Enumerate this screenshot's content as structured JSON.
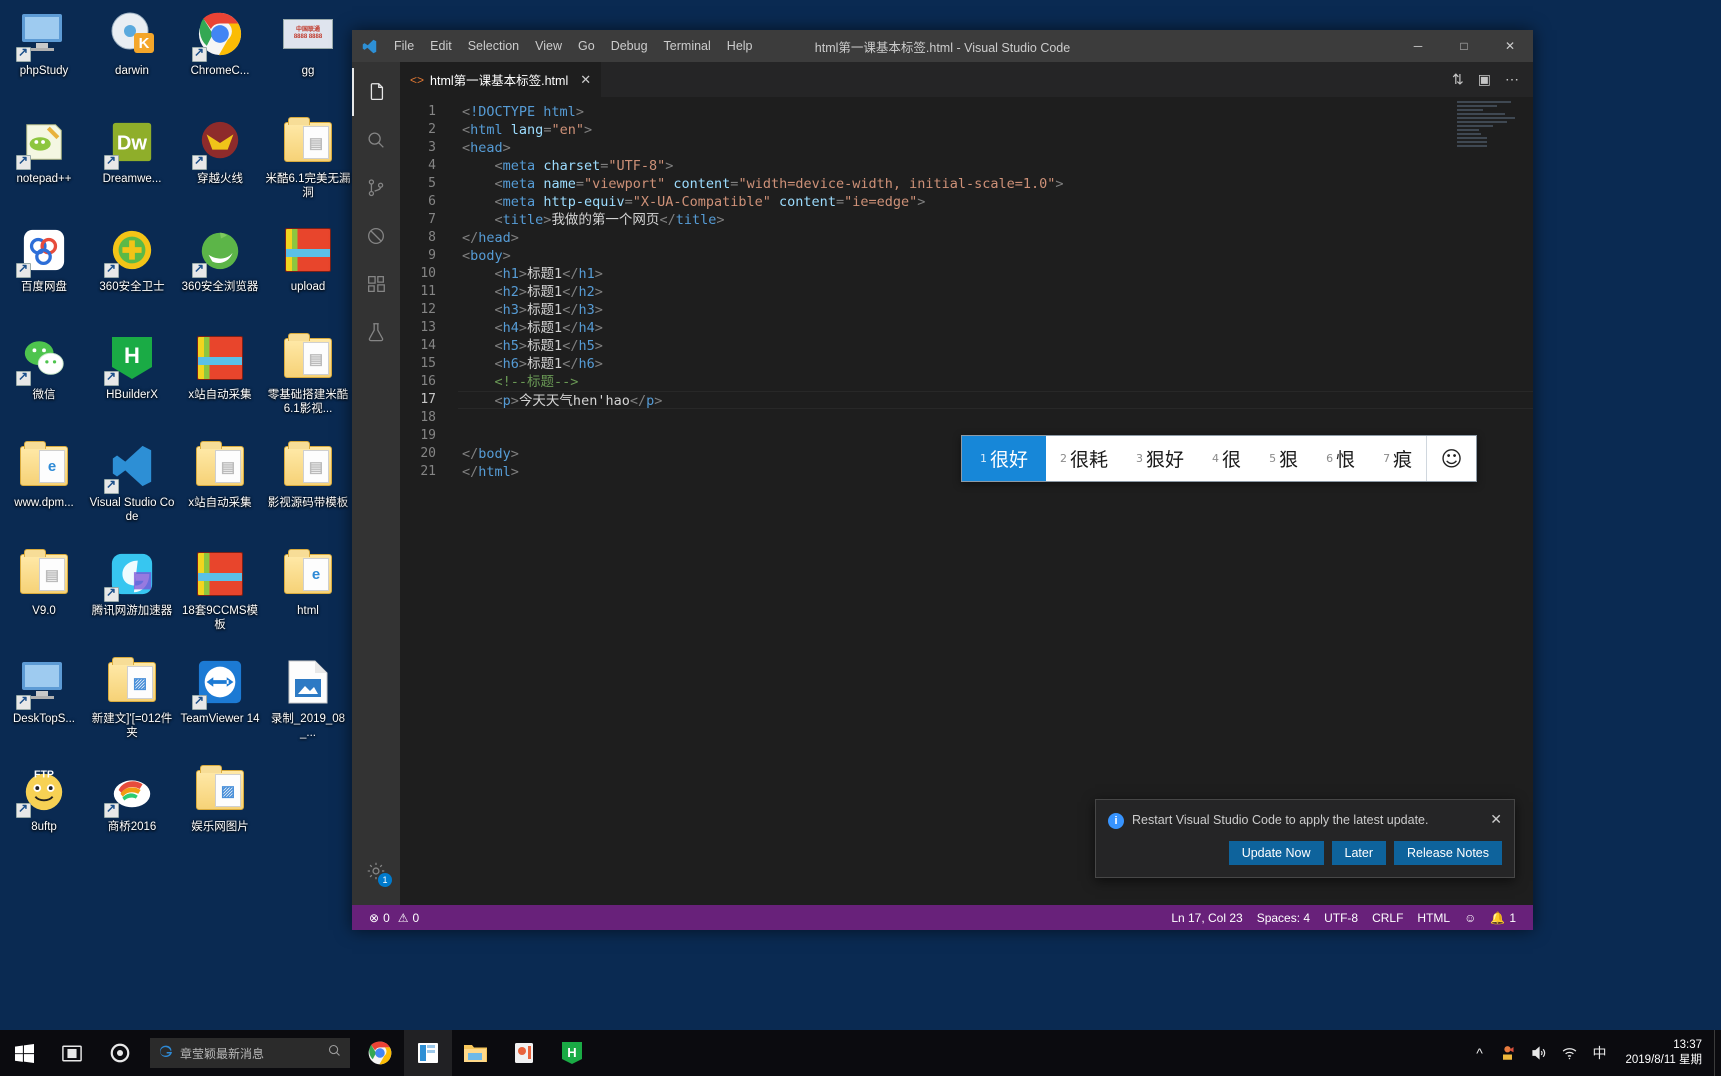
{
  "desktop": {
    "icons": [
      {
        "label": "phpStudy",
        "glyph": "monitor",
        "shortcut": true
      },
      {
        "label": "darwin",
        "glyph": "disc-k",
        "shortcut": false
      },
      {
        "label": "ChromeC...",
        "glyph": "chrome",
        "shortcut": true
      },
      {
        "label": "gg",
        "glyph": "card",
        "shortcut": false
      },
      {
        "label": "notepad++",
        "glyph": "notepad",
        "shortcut": true
      },
      {
        "label": "Dreamwe...",
        "glyph": "dreamweaver",
        "shortcut": true
      },
      {
        "label": "穿越火线",
        "glyph": "cf-game",
        "shortcut": true
      },
      {
        "label": "米酷6.1完美无漏洞",
        "glyph": "folder",
        "shortcut": false
      },
      {
        "label": "百度网盘",
        "glyph": "baidu-netdisk",
        "shortcut": true
      },
      {
        "label": "360安全卫士",
        "glyph": "360-guard",
        "shortcut": true
      },
      {
        "label": "360安全浏览器",
        "glyph": "360-browser",
        "shortcut": true
      },
      {
        "label": "upload",
        "glyph": "zip",
        "shortcut": false
      },
      {
        "label": "微信",
        "glyph": "wechat",
        "shortcut": true
      },
      {
        "label": "HBuilderX",
        "glyph": "hbuilderx",
        "shortcut": true
      },
      {
        "label": "x站自动采集",
        "glyph": "zip",
        "shortcut": false
      },
      {
        "label": "零基础搭建米酷6.1影视...",
        "glyph": "folder",
        "shortcut": false
      },
      {
        "label": "www.dpm...",
        "glyph": "folder-ie",
        "shortcut": false
      },
      {
        "label": "Visual Studio Code",
        "glyph": "vscode",
        "shortcut": true
      },
      {
        "label": "x站自动采集",
        "glyph": "folder",
        "shortcut": false
      },
      {
        "label": "影视源码带模板",
        "glyph": "folder",
        "shortcut": false
      },
      {
        "label": "V9.0",
        "glyph": "folder",
        "shortcut": false
      },
      {
        "label": "腾讯网游加速器",
        "glyph": "tencent-accel",
        "shortcut": true
      },
      {
        "label": "18套9CCMS模板",
        "glyph": "zip",
        "shortcut": false
      },
      {
        "label": "html",
        "glyph": "folder-ie",
        "shortcut": false
      },
      {
        "label": "DeskTopS...",
        "glyph": "monitor",
        "shortcut": true
      },
      {
        "label": "新建文]'[=012件夹",
        "glyph": "folder-photo",
        "shortcut": false
      },
      {
        "label": "TeamViewer 14",
        "glyph": "teamviewer",
        "shortcut": true
      },
      {
        "label": "录制_2019_08_...",
        "glyph": "image-file",
        "shortcut": false
      },
      {
        "label": "8uftp",
        "glyph": "ftp",
        "shortcut": true
      },
      {
        "label": "商桥2016",
        "glyph": "shangqiao",
        "shortcut": true
      },
      {
        "label": "娱乐网图片",
        "glyph": "folder-photo",
        "shortcut": false
      }
    ]
  },
  "vscode": {
    "window_title": "html第一课基本标签.html - Visual Studio Code",
    "menu": [
      "File",
      "Edit",
      "Selection",
      "View",
      "Go",
      "Debug",
      "Terminal",
      "Help"
    ],
    "window_controls": {
      "minimize": "─",
      "maximize": "□",
      "close": "✕"
    },
    "tab": {
      "label": "html第一课基本标签.html",
      "close": "✕",
      "icon": "html-file-icon"
    },
    "tab_actions": [
      "split-editor-icon",
      "layout-icon",
      "more-actions-icon"
    ],
    "activity_bar": [
      {
        "name": "explorer",
        "icon": "files-icon",
        "active": true
      },
      {
        "name": "search",
        "icon": "search-icon",
        "active": false
      },
      {
        "name": "source-control",
        "icon": "source-control-icon",
        "active": false
      },
      {
        "name": "debug",
        "icon": "debug-icon",
        "active": false
      },
      {
        "name": "extensions",
        "icon": "extensions-icon",
        "active": false
      },
      {
        "name": "testing",
        "icon": "beaker-icon",
        "active": false
      }
    ],
    "settings_badge": "1",
    "editor": {
      "cursor_line": 17,
      "lines": [
        {
          "n": 1,
          "tokens": [
            {
              "t": "punc",
              "v": "<"
            },
            {
              "t": "tag",
              "v": "!DOCTYPE html"
            },
            {
              "t": "punc",
              "v": ">"
            }
          ]
        },
        {
          "n": 2,
          "tokens": [
            {
              "t": "punc",
              "v": "<"
            },
            {
              "t": "tag",
              "v": "html"
            },
            {
              "t": "text",
              "v": " "
            },
            {
              "t": "attr",
              "v": "lang"
            },
            {
              "t": "punc",
              "v": "="
            },
            {
              "t": "str",
              "v": "\"en\""
            },
            {
              "t": "punc",
              "v": ">"
            }
          ]
        },
        {
          "n": 3,
          "tokens": [
            {
              "t": "punc",
              "v": "<"
            },
            {
              "t": "tag",
              "v": "head"
            },
            {
              "t": "punc",
              "v": ">"
            }
          ]
        },
        {
          "n": 4,
          "tokens": [
            {
              "t": "text",
              "v": "    "
            },
            {
              "t": "punc",
              "v": "<"
            },
            {
              "t": "tag",
              "v": "meta"
            },
            {
              "t": "text",
              "v": " "
            },
            {
              "t": "attr",
              "v": "charset"
            },
            {
              "t": "punc",
              "v": "="
            },
            {
              "t": "str",
              "v": "\"UTF-8\""
            },
            {
              "t": "punc",
              "v": ">"
            }
          ]
        },
        {
          "n": 5,
          "tokens": [
            {
              "t": "text",
              "v": "    "
            },
            {
              "t": "punc",
              "v": "<"
            },
            {
              "t": "tag",
              "v": "meta"
            },
            {
              "t": "text",
              "v": " "
            },
            {
              "t": "attr",
              "v": "name"
            },
            {
              "t": "punc",
              "v": "="
            },
            {
              "t": "str",
              "v": "\"viewport\""
            },
            {
              "t": "text",
              "v": " "
            },
            {
              "t": "attr",
              "v": "content"
            },
            {
              "t": "punc",
              "v": "="
            },
            {
              "t": "str",
              "v": "\"width=device-width, initial-scale=1.0\""
            },
            {
              "t": "punc",
              "v": ">"
            }
          ]
        },
        {
          "n": 6,
          "tokens": [
            {
              "t": "text",
              "v": "    "
            },
            {
              "t": "punc",
              "v": "<"
            },
            {
              "t": "tag",
              "v": "meta"
            },
            {
              "t": "text",
              "v": " "
            },
            {
              "t": "attr",
              "v": "http-equiv"
            },
            {
              "t": "punc",
              "v": "="
            },
            {
              "t": "str",
              "v": "\"X-UA-Compatible\""
            },
            {
              "t": "text",
              "v": " "
            },
            {
              "t": "attr",
              "v": "content"
            },
            {
              "t": "punc",
              "v": "="
            },
            {
              "t": "str",
              "v": "\"ie=edge\""
            },
            {
              "t": "punc",
              "v": ">"
            }
          ]
        },
        {
          "n": 7,
          "tokens": [
            {
              "t": "text",
              "v": "    "
            },
            {
              "t": "punc",
              "v": "<"
            },
            {
              "t": "tag",
              "v": "title"
            },
            {
              "t": "punc",
              "v": ">"
            },
            {
              "t": "text",
              "v": "我做的第一个网页"
            },
            {
              "t": "punc",
              "v": "</"
            },
            {
              "t": "tag",
              "v": "title"
            },
            {
              "t": "punc",
              "v": ">"
            }
          ]
        },
        {
          "n": 8,
          "tokens": [
            {
              "t": "punc",
              "v": "</"
            },
            {
              "t": "tag",
              "v": "head"
            },
            {
              "t": "punc",
              "v": ">"
            }
          ]
        },
        {
          "n": 9,
          "tokens": [
            {
              "t": "punc",
              "v": "<"
            },
            {
              "t": "tag",
              "v": "body"
            },
            {
              "t": "punc",
              "v": ">"
            }
          ]
        },
        {
          "n": 10,
          "tokens": [
            {
              "t": "text",
              "v": "    "
            },
            {
              "t": "punc",
              "v": "<"
            },
            {
              "t": "tag",
              "v": "h1"
            },
            {
              "t": "punc",
              "v": ">"
            },
            {
              "t": "text",
              "v": "标题1"
            },
            {
              "t": "punc",
              "v": "</"
            },
            {
              "t": "tag",
              "v": "h1"
            },
            {
              "t": "punc",
              "v": ">"
            }
          ]
        },
        {
          "n": 11,
          "tokens": [
            {
              "t": "text",
              "v": "    "
            },
            {
              "t": "punc",
              "v": "<"
            },
            {
              "t": "tag",
              "v": "h2"
            },
            {
              "t": "punc",
              "v": ">"
            },
            {
              "t": "text",
              "v": "标题1"
            },
            {
              "t": "punc",
              "v": "</"
            },
            {
              "t": "tag",
              "v": "h2"
            },
            {
              "t": "punc",
              "v": ">"
            }
          ]
        },
        {
          "n": 12,
          "tokens": [
            {
              "t": "text",
              "v": "    "
            },
            {
              "t": "punc",
              "v": "<"
            },
            {
              "t": "tag",
              "v": "h3"
            },
            {
              "t": "punc",
              "v": ">"
            },
            {
              "t": "text",
              "v": "标题1"
            },
            {
              "t": "punc",
              "v": "</"
            },
            {
              "t": "tag",
              "v": "h3"
            },
            {
              "t": "punc",
              "v": ">"
            }
          ]
        },
        {
          "n": 13,
          "tokens": [
            {
              "t": "text",
              "v": "    "
            },
            {
              "t": "punc",
              "v": "<"
            },
            {
              "t": "tag",
              "v": "h4"
            },
            {
              "t": "punc",
              "v": ">"
            },
            {
              "t": "text",
              "v": "标题1"
            },
            {
              "t": "punc",
              "v": "</"
            },
            {
              "t": "tag",
              "v": "h4"
            },
            {
              "t": "punc",
              "v": ">"
            }
          ]
        },
        {
          "n": 14,
          "tokens": [
            {
              "t": "text",
              "v": "    "
            },
            {
              "t": "punc",
              "v": "<"
            },
            {
              "t": "tag",
              "v": "h5"
            },
            {
              "t": "punc",
              "v": ">"
            },
            {
              "t": "text",
              "v": "标题1"
            },
            {
              "t": "punc",
              "v": "</"
            },
            {
              "t": "tag",
              "v": "h5"
            },
            {
              "t": "punc",
              "v": ">"
            }
          ]
        },
        {
          "n": 15,
          "tokens": [
            {
              "t": "text",
              "v": "    "
            },
            {
              "t": "punc",
              "v": "<"
            },
            {
              "t": "tag",
              "v": "h6"
            },
            {
              "t": "punc",
              "v": ">"
            },
            {
              "t": "text",
              "v": "标题1"
            },
            {
              "t": "punc",
              "v": "</"
            },
            {
              "t": "tag",
              "v": "h6"
            },
            {
              "t": "punc",
              "v": ">"
            }
          ]
        },
        {
          "n": 16,
          "tokens": [
            {
              "t": "text",
              "v": "    "
            },
            {
              "t": "comment",
              "v": "<!--标题-->"
            }
          ]
        },
        {
          "n": 17,
          "tokens": [
            {
              "t": "text",
              "v": "    "
            },
            {
              "t": "punc",
              "v": "<"
            },
            {
              "t": "tag",
              "v": "p"
            },
            {
              "t": "punc",
              "v": ">"
            },
            {
              "t": "text",
              "v": "今天天气hen'hao"
            },
            {
              "t": "punc",
              "v": "</"
            },
            {
              "t": "tag",
              "v": "p"
            },
            {
              "t": "punc",
              "v": ">"
            }
          ]
        },
        {
          "n": 18,
          "tokens": []
        },
        {
          "n": 19,
          "tokens": []
        },
        {
          "n": 20,
          "tokens": [
            {
              "t": "punc",
              "v": "</"
            },
            {
              "t": "tag",
              "v": "body"
            },
            {
              "t": "punc",
              "v": ">"
            }
          ]
        },
        {
          "n": 21,
          "tokens": [
            {
              "t": "punc",
              "v": "</"
            },
            {
              "t": "tag",
              "v": "html"
            },
            {
              "t": "punc",
              "v": ">"
            }
          ]
        }
      ]
    },
    "notification": {
      "message": "Restart Visual Studio Code to apply the latest update.",
      "close": "✕",
      "buttons": [
        "Update Now",
        "Later",
        "Release Notes"
      ]
    },
    "status_bar": {
      "errors": "0",
      "warnings": "0",
      "position": "Ln 17, Col 23",
      "indentation": "Spaces: 4",
      "encoding": "UTF-8",
      "eol": "CRLF",
      "language": "HTML",
      "feedback_icon": "smiley-icon",
      "bell_icon": "bell-icon",
      "bell_count": "1"
    }
  },
  "ime": {
    "candidates": [
      {
        "num": "1",
        "text": "很好",
        "selected": true
      },
      {
        "num": "2",
        "text": "很耗",
        "selected": false
      },
      {
        "num": "3",
        "text": "狠好",
        "selected": false
      },
      {
        "num": "4",
        "text": "很",
        "selected": false
      },
      {
        "num": "5",
        "text": "狠",
        "selected": false
      },
      {
        "num": "6",
        "text": "恨",
        "selected": false
      },
      {
        "num": "7",
        "text": "痕",
        "selected": false
      }
    ],
    "emoji_button": "☺"
  },
  "taskbar": {
    "start_icon": "windows-start-icon",
    "task_view_icon": "task-view-icon",
    "cortana_icon": "cortana-icon",
    "search": {
      "value": "章莹颖最新消息",
      "icon": "ie-icon",
      "search_icon": "search-icon"
    },
    "pinned": [
      {
        "name": "chrome",
        "icon": "chrome-icon",
        "running": false
      },
      {
        "name": "vscode",
        "icon": "vscode-icon",
        "running": true
      },
      {
        "name": "file-explorer",
        "icon": "folder-icon",
        "running": false
      },
      {
        "name": "media-player",
        "icon": "media-icon",
        "running": false
      },
      {
        "name": "hbuilderx",
        "icon": "hbuilderx-icon",
        "running": false
      }
    ],
    "tray": [
      {
        "name": "show-hidden-icons",
        "glyph": "^"
      },
      {
        "name": "security-icon",
        "glyph": "🛡"
      },
      {
        "name": "volume-icon",
        "glyph": "🔊"
      },
      {
        "name": "network-icon",
        "glyph": "📶"
      },
      {
        "name": "ime-mode-icon",
        "glyph": "中"
      }
    ],
    "clock": {
      "time": "13:37",
      "date": "2019/8/11 星期"
    }
  }
}
